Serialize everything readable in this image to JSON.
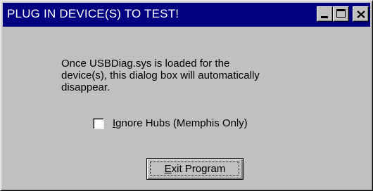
{
  "window": {
    "title": "PLUG IN DEVICE(S) TO TEST!",
    "title_bar_color": "#000080",
    "face_color": "#c0c0c0",
    "controls": {
      "minimize_icon": "minimize-icon",
      "maximize_icon": "maximize-icon",
      "close_icon": "close-icon"
    }
  },
  "message": {
    "line1": "Once USBDiag.sys is loaded for the",
    "line2": "device(s), this dialog box will automatically",
    "line3": "disappear."
  },
  "checkbox": {
    "label_mnemonic": "I",
    "label_rest": "gnore Hubs (Memphis Only)",
    "checked": false
  },
  "exit_button": {
    "label_mnemonic": "E",
    "label_rest": "xit Program"
  }
}
